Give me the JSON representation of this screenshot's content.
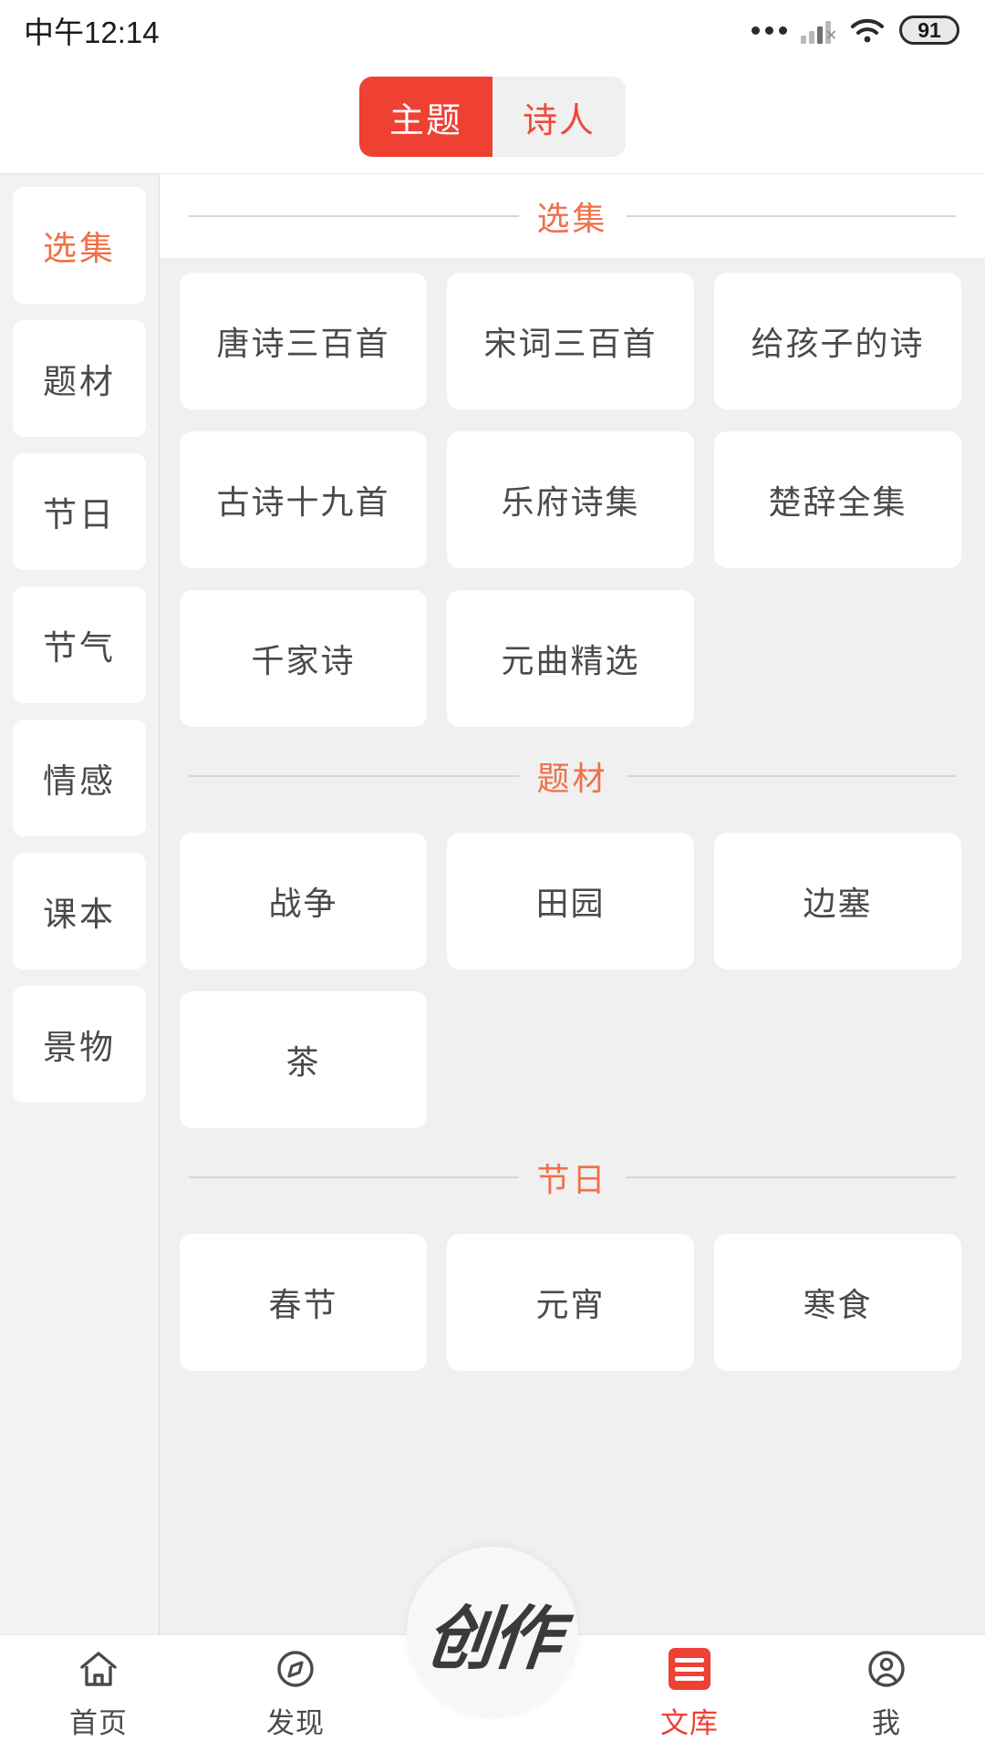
{
  "statusbar": {
    "time": "中午12:14",
    "battery_level": "91",
    "icons": {
      "more": "more-dots-icon",
      "signal": "cellular-signal-off-icon",
      "wifi": "wifi-icon",
      "battery": "battery-icon"
    }
  },
  "segmented_tabs": {
    "items": [
      {
        "label": "主题",
        "active": true
      },
      {
        "label": "诗人",
        "active": false
      }
    ],
    "active_color": "#ee4033",
    "inactive_bg": "#f0f0f0"
  },
  "sidebar": {
    "items": [
      {
        "label": "选集",
        "active": true
      },
      {
        "label": "题材",
        "active": false
      },
      {
        "label": "节日",
        "active": false
      },
      {
        "label": "节气",
        "active": false
      },
      {
        "label": "情感",
        "active": false
      },
      {
        "label": "课本",
        "active": false
      },
      {
        "label": "景物",
        "active": false
      }
    ],
    "active_color": "#f1704a"
  },
  "content": {
    "accent_color": "#f1704a",
    "sections": [
      {
        "title": "选集",
        "cards": [
          "唐诗三百首",
          "宋词三百首",
          "给孩子的诗",
          "古诗十九首",
          "乐府诗集",
          "楚辞全集",
          "千家诗",
          "元曲精选"
        ]
      },
      {
        "title": "题材",
        "cards": [
          "战争",
          "田园",
          "边塞",
          "茶"
        ]
      },
      {
        "title": "节日",
        "cards": [
          "春节",
          "元宵",
          "寒食"
        ]
      }
    ]
  },
  "fab": {
    "label": "创作"
  },
  "tabbar": {
    "items": [
      {
        "label": "首页",
        "icon": "home-icon",
        "active": false
      },
      {
        "label": "发现",
        "icon": "compass-icon",
        "active": false
      },
      {
        "label": "文库",
        "icon": "library-list-icon",
        "active": true
      },
      {
        "label": "我",
        "icon": "user-account-icon",
        "active": false
      }
    ],
    "active_color": "#ee4033"
  }
}
